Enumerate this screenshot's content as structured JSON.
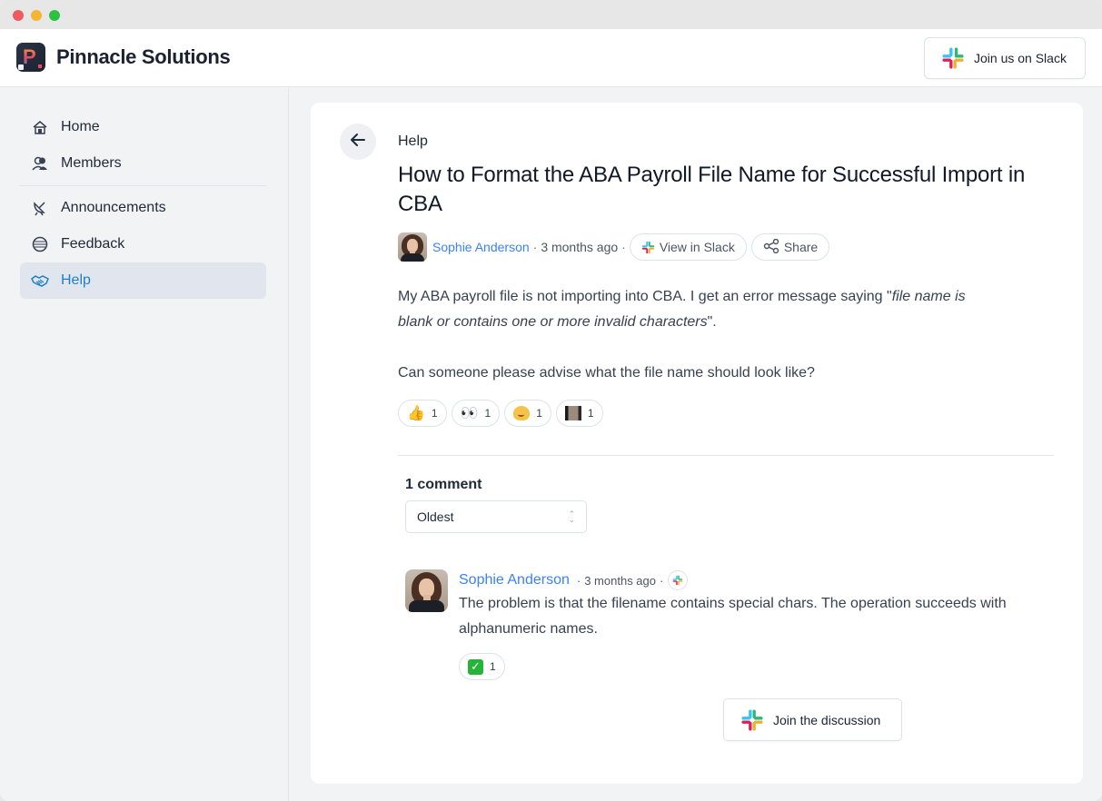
{
  "window": {
    "controls": [
      "close",
      "minimize",
      "maximize"
    ]
  },
  "header": {
    "brand": "Pinnacle Solutions",
    "logo_icon": "pinnacle-logo",
    "slack_button_label": "Join us on Slack",
    "slack_icon": "slack-logo"
  },
  "sidebar": {
    "items": [
      {
        "label": "Home",
        "icon": "house-icon",
        "glyph": "🏠",
        "active": false
      },
      {
        "label": "Members",
        "icon": "members-icon",
        "glyph": "👥",
        "active": false
      },
      {
        "label": "Announcements",
        "icon": "satellite-dish-icon",
        "glyph": "📡",
        "active": false
      },
      {
        "label": "Feedback",
        "icon": "feedback-globe-icon",
        "glyph": "◍",
        "active": false
      },
      {
        "label": "Help",
        "icon": "handshake-icon",
        "glyph": "🤝",
        "active": true
      }
    ]
  },
  "post": {
    "back_icon": "arrow-left-icon",
    "breadcrumb": "Help",
    "title": "How to Format the ABA Payroll File Name for Successful Import in CBA",
    "author": "Sophie Anderson",
    "time": "3 months ago",
    "separator": "·",
    "view_in_slack_label": "View in Slack",
    "share_label": "Share",
    "body": {
      "p1_prefix": "My ABA payroll file is not importing into CBA. I get an error message saying \"",
      "p1_italic": "file name is blank or contains one or more invalid characters",
      "p1_suffix": "\".",
      "p2": "Can someone please advise what the file name should look like?"
    },
    "reactions": [
      {
        "emoji": "thumbs-up",
        "glyph": "👍",
        "count": "1"
      },
      {
        "emoji": "eyes",
        "glyph": "👀",
        "count": "1"
      },
      {
        "emoji": "melting-face",
        "glyph": "🫠",
        "count": "1"
      },
      {
        "emoji": "custom-image",
        "glyph": "",
        "count": "1"
      }
    ]
  },
  "comments": {
    "count_label": "1 comment",
    "sort": {
      "selected": "Oldest"
    },
    "items": [
      {
        "author": "Sophie Anderson",
        "time": "3 months ago",
        "text": "The problem is that the filename contains special chars. The operation succeeds with alphanumeric names.",
        "reactions": [
          {
            "emoji": "white-check-mark",
            "glyph": "✓",
            "count": "1"
          }
        ]
      }
    ],
    "join_label": "Join the discussion"
  },
  "colors": {
    "accent": "#1f7fc4",
    "link": "#3b82f6",
    "active_nav_bg": "#e1e6ee",
    "slack_blue": "#36c5f0",
    "slack_green": "#2eb67d",
    "slack_yellow": "#ecb22e",
    "slack_red": "#e01e5a"
  }
}
